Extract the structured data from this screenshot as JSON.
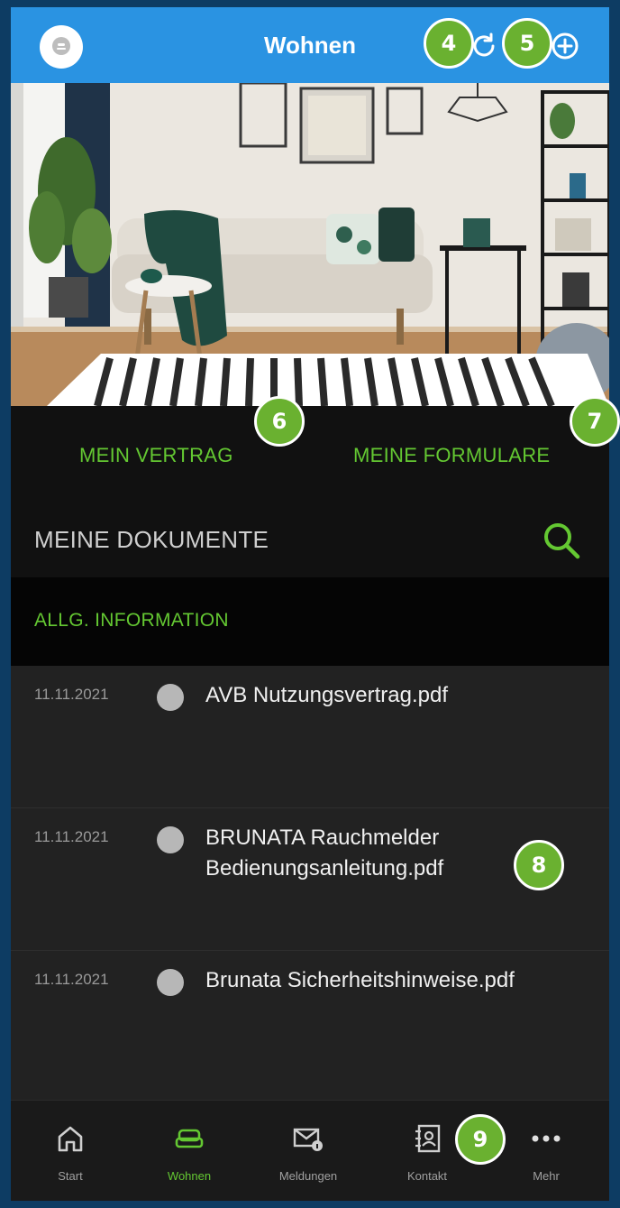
{
  "header": {
    "title": "Wohnen"
  },
  "tabs": [
    {
      "label": "MEIN VERTRAG"
    },
    {
      "label": "MEINE FORMULARE"
    }
  ],
  "documents": {
    "title": "MEINE DOKUMENTE",
    "section": "ALLG. INFORMATION",
    "items": [
      {
        "date": "11.11.2021",
        "name": "AVB Nutzungsvertrag.pdf"
      },
      {
        "date": "11.11.2021",
        "name": "BRUNATA Rauchmelder Bedienungsanleitung.pdf"
      },
      {
        "date": "11.11.2021",
        "name": "Brunata Sicherheitshinweise.pdf"
      }
    ]
  },
  "bottom_nav": [
    {
      "label": "Start",
      "icon": "home-icon"
    },
    {
      "label": "Wohnen",
      "icon": "sofa-icon",
      "active": true
    },
    {
      "label": "Meldungen",
      "icon": "mail-info-icon"
    },
    {
      "label": "Kontakt",
      "icon": "contact-book-icon"
    },
    {
      "label": "Mehr",
      "icon": "more-dots-icon"
    }
  ],
  "markers": [
    "4",
    "5",
    "6",
    "7",
    "8",
    "9"
  ],
  "colors": {
    "header": "#2a93e2",
    "accent": "#64c832",
    "marker": "#6ab130",
    "background": "#0d3c63"
  }
}
